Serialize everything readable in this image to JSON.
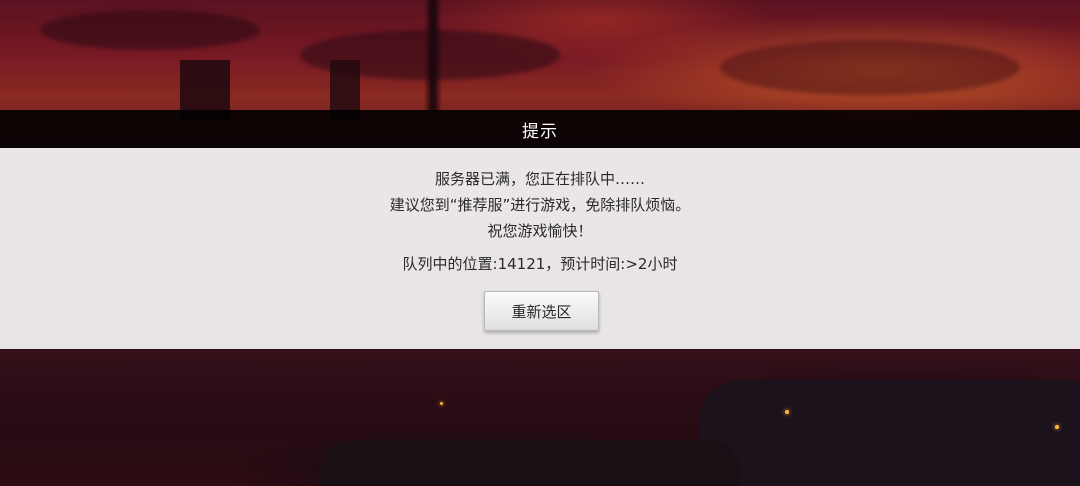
{
  "dialog": {
    "title": "提示",
    "message_line1": "服务器已满，您正在排队中……",
    "message_line2": "建议您到“推荐服”进行游戏，免除排队烦恼。",
    "message_line3": "祝您游戏愉快！",
    "queue_info": "队列中的位置:14121，预计时间:>2小时",
    "reselect_button": "重新选区"
  },
  "colors": {
    "title_bar": "#000000",
    "panel": "#f0eeee",
    "sky": "#7a1a24"
  }
}
